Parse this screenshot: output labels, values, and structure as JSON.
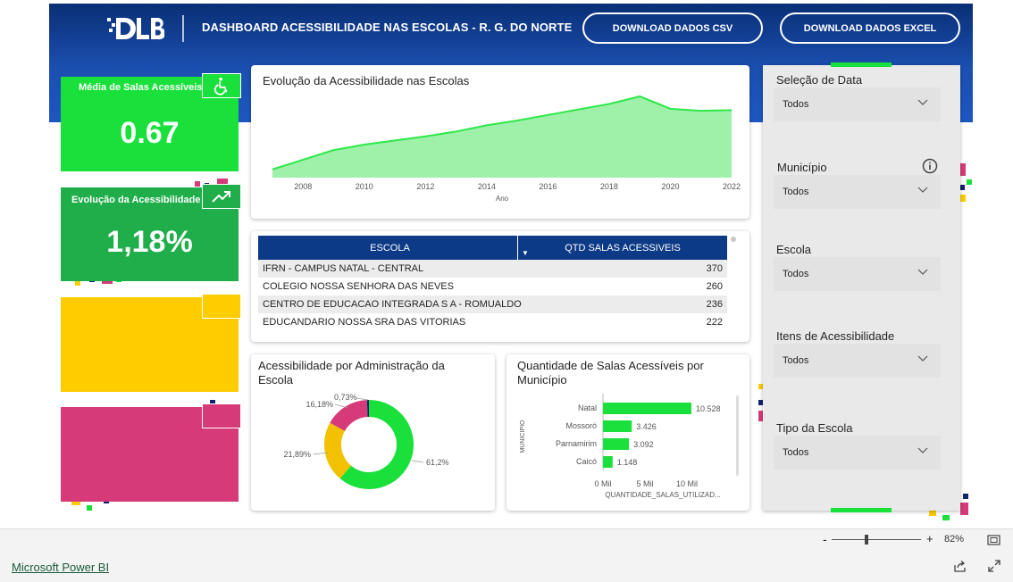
{
  "header": {
    "title": "DASHBOARD ACESSIBILIDADE NAS ESCOLAS - R. G. DO NORTE",
    "btn_csv": "DOWNLOAD DADOS CSV",
    "btn_excel": "DOWNLOAD DADOS EXCEL",
    "brand_color": "#1b4fb0"
  },
  "kpis": [
    {
      "label": "Média de Salas Acessíveis",
      "value": "0.67",
      "color": "#19e03a",
      "icon": "wheelchair-icon"
    },
    {
      "label": "Evolução da Acessibilidade",
      "value": "1,18%",
      "color": "#1fae4a",
      "icon": "trending-up-icon"
    },
    {
      "label": "",
      "value": "",
      "color": "#ffcc00",
      "icon": ""
    },
    {
      "label": "",
      "value": "",
      "color": "#d63a78",
      "icon": ""
    }
  ],
  "line_chart": {
    "title": "Evolução da Acessibilidade nas Escolas",
    "xlabel": "Ano",
    "ticks": [
      "2008",
      "2010",
      "2012",
      "2014",
      "2016",
      "2018",
      "2020",
      "2022"
    ]
  },
  "table": {
    "col1": "ESCOLA",
    "col2": "QTD SALAS ACESSIVEIS",
    "rows": [
      {
        "escola": "IFRN - CAMPUS NATAL - CENTRAL",
        "qtd": "370"
      },
      {
        "escola": "COLEGIO NOSSA SENHORA DAS NEVES",
        "qtd": "260"
      },
      {
        "escola": "CENTRO DE EDUCACAO INTEGRADA S A - ROMUALDO",
        "qtd": "236"
      },
      {
        "escola": "EDUCANDARIO NOSSA SRA DAS VITORIAS",
        "qtd": "222"
      }
    ]
  },
  "donut": {
    "title_line1": "Acessibilidade por Administração da",
    "title_line2": "Escola",
    "labels": [
      "61,2%",
      "21,89%",
      "16,18%",
      "0,73%"
    ]
  },
  "bars": {
    "title_line1": "Quantidade de Salas Acessíveis por",
    "title_line2": "Município",
    "ylabel": "MUNICIPIO",
    "xlabel": "QUANTIDADE_SALAS_UTILIZAD...",
    "ticks": [
      "0 Mil",
      "5 Mil",
      "10 Mil"
    ],
    "value_labels": [
      "10.528",
      "3.426",
      "3.092",
      "1.148"
    ]
  },
  "chart_data": [
    {
      "type": "area",
      "title": "Evolução da Acessibilidade nas Escolas",
      "xlabel": "Ano",
      "ylabel": "",
      "x": [
        2007,
        2008,
        2009,
        2010,
        2011,
        2012,
        2013,
        2014,
        2015,
        2016,
        2017,
        2018,
        2019,
        2020,
        2021,
        2022
      ],
      "values": [
        0.12,
        0.26,
        0.4,
        0.48,
        0.54,
        0.6,
        0.67,
        0.76,
        0.83,
        0.91,
        0.99,
        1.07,
        1.18,
        1.0,
        0.97,
        0.98
      ],
      "ylim": [
        0,
        1.4
      ],
      "color": "#9ff0a8",
      "line_color": "#2ee84a"
    },
    {
      "type": "pie",
      "labels": [
        "61,2%",
        "21,89%",
        "16,18%",
        "0,73%"
      ],
      "values": [
        61.2,
        21.89,
        16.18,
        0.73
      ],
      "colors": [
        "#19e03a",
        "#f2c200",
        "#d63a78",
        "#12246b"
      ]
    },
    {
      "type": "bar",
      "orientation": "horizontal",
      "categories": [
        "Natal",
        "Mossoró",
        "Parnamirim",
        "Caicó"
      ],
      "values": [
        10528,
        3426,
        3092,
        1148
      ],
      "xlim": [
        0,
        10000
      ],
      "color": "#19e03a"
    }
  ],
  "slicers": [
    {
      "label": "Seleção de Data",
      "value": "Todos"
    },
    {
      "label": "Município",
      "value": "Todos"
    },
    {
      "label": "Escola",
      "value": "Todos"
    },
    {
      "label": "Itens de Acessibilidade",
      "value": "Todos"
    },
    {
      "label": "Tipo da Escola",
      "value": "Todos"
    }
  ],
  "footer": {
    "zoom": "82%",
    "minus": "-",
    "plus": "+",
    "powerbi": "Microsoft Power BI"
  }
}
